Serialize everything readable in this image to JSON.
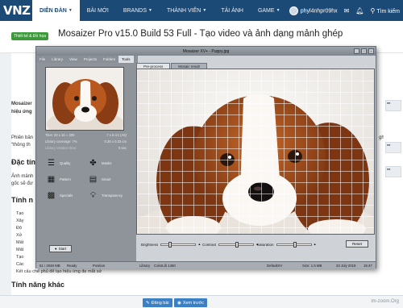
{
  "forum_nav": {
    "logo": "VNZ",
    "items": [
      {
        "label": "DIỄN ĐÀN",
        "active": true
      },
      {
        "label": "BÀI MỚI",
        "active": false
      },
      {
        "label": "BRANDS",
        "active": false
      },
      {
        "label": "THÀNH VIÊN",
        "active": false
      },
      {
        "label": "TẢI ẢNH",
        "active": false
      },
      {
        "label": "GAME",
        "active": false
      }
    ],
    "username": "phyl4nhpr09hx",
    "search_label": "Tìm kiếm",
    "icons": [
      "user-icon",
      "mail-icon",
      "bell-icon",
      "search-icon"
    ]
  },
  "thread": {
    "tag": "Thiết kế & Đồ họa",
    "title": "Mosaizer Pro v15.0 Build 53 Full - Tạo video và ảnh dạng mảnh ghép"
  },
  "article": {
    "p1_start": "Mosaizer",
    "p1_line2": "hiệu ứng",
    "p2_start": "Phiên bản",
    "p2_line2": "“thông th",
    "p2_right": "ghép",
    "h_features": "Đặc tính",
    "p3_start": "Ảnh mảnh",
    "p3_line2": "gốc sẽ đư",
    "h_features2": "Tính n",
    "bullets": [
      "Tạo",
      "Xây",
      "Độ",
      "Xử",
      "Mất",
      "Mất",
      "Tạo",
      "Các"
    ],
    "last_line": "Kết cấu chế phủ để tạo hiệu ứng đẹ mắt sử",
    "h_other": "Tính năng khác"
  },
  "app": {
    "title": "Mosaizer XV+ - Puppy.jpg",
    "menu": [
      "File",
      "Library",
      "View",
      "Projects",
      "Folders",
      "Tools"
    ],
    "active_menu": "Tools",
    "info": {
      "tiles_label": "Tiles: 20 x 15 = 300",
      "tiles_size": "7 x 5 cm (A5)",
      "coverage_label": "Library coverage: 7%",
      "coverage_size": "0.36 x 0.33 cm",
      "time_label": "Library creation time:",
      "time_value": "0 sec"
    },
    "tools": [
      {
        "label": "Quality",
        "icon": "quality-sliders-icon"
      },
      {
        "label": "Masks",
        "icon": "masks-puzzle-icon"
      },
      {
        "label": "Pattern",
        "icon": "pattern-grid-icon"
      },
      {
        "label": "Smart",
        "icon": "smart-grid-icon"
      },
      {
        "label": "Specials",
        "icon": "specials-grid-icon"
      },
      {
        "label": "Transparency",
        "icon": "transparency-bulb-icon"
      }
    ],
    "start_label": "Start",
    "tabs": [
      "Pre-process",
      "Mosaic result"
    ],
    "active_tab": "Pre-process",
    "adjust": {
      "brightness": "Brightness",
      "contrast": "Contrast",
      "saturation": "Saturation",
      "reset": "Reset",
      "brightness_level": 0.25,
      "contrast_level": 0.5,
      "saturation_level": 0.5
    },
    "status": {
      "memory": "51 / 2048 MB",
      "state": "Ready",
      "position": "Position",
      "library": "Library",
      "colorlib": "ColorLib 1450",
      "mode": "DefaultXV",
      "size": "Size: 1.5 MB",
      "date": "23 July 2019",
      "time": "15:47"
    }
  },
  "bottom": {
    "post_label": "Đăng bài",
    "preview_label": "Xem trước",
    "watermark": "im-zoom.Org"
  },
  "colors": {
    "nav_bg": "#1b4a77",
    "accent": "#3b7fc4",
    "tag_green": "#3d9a3a"
  }
}
